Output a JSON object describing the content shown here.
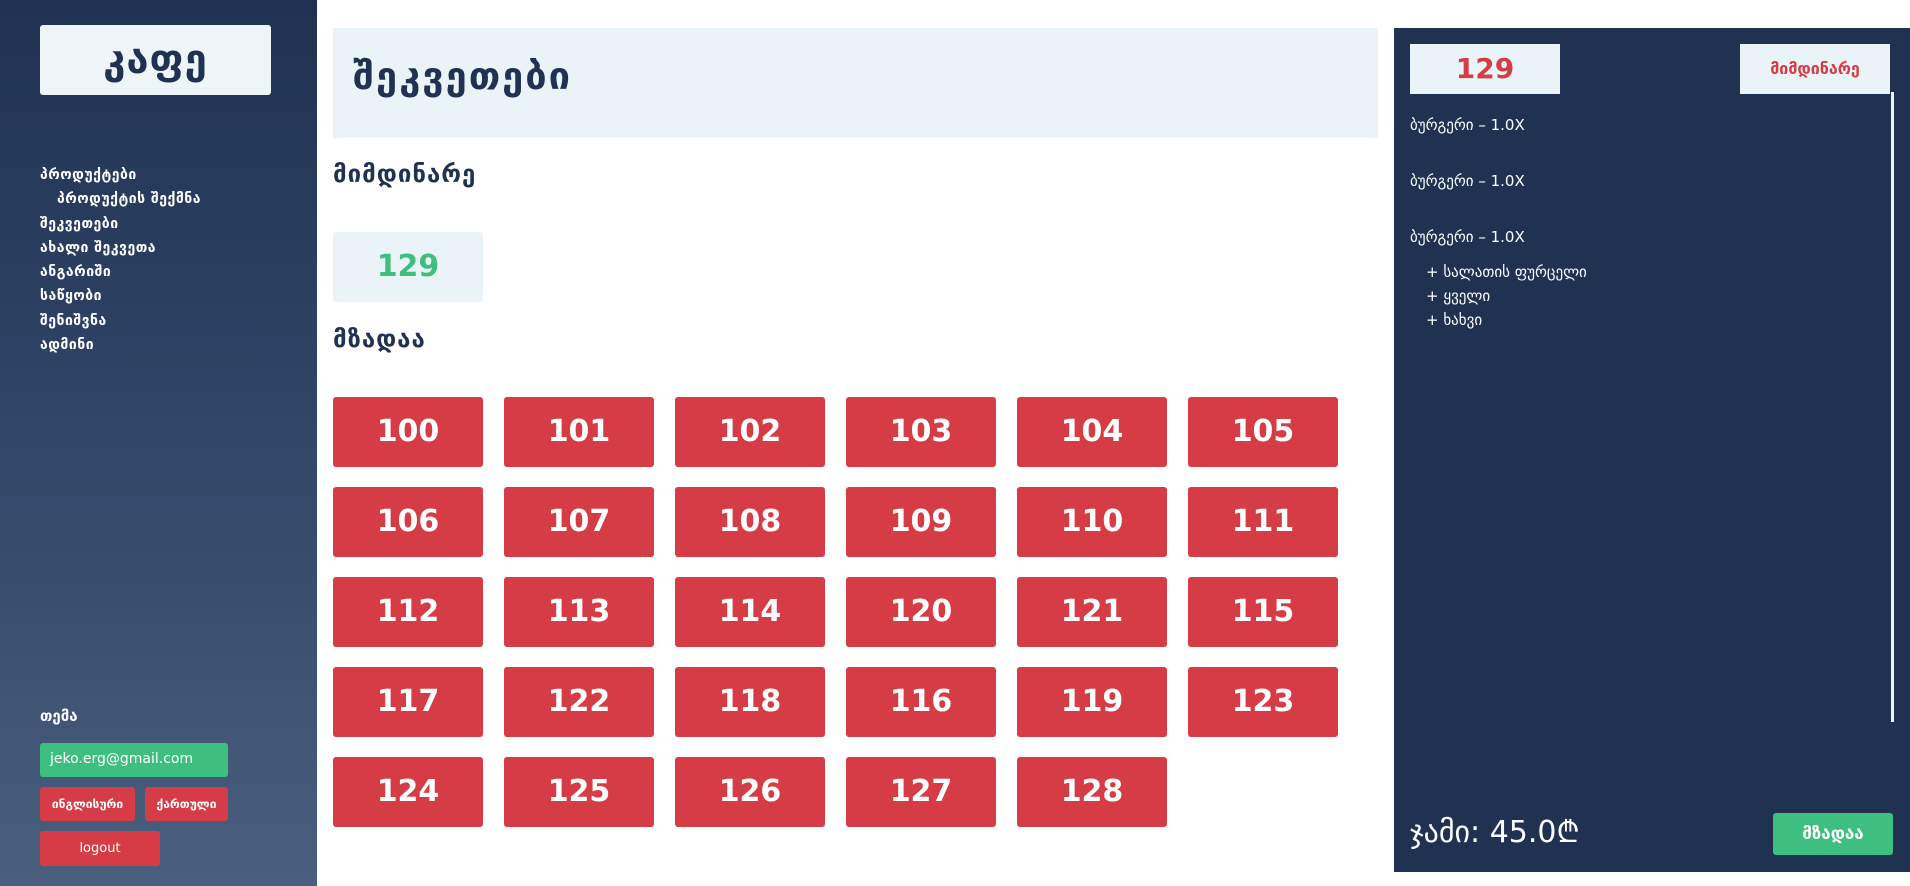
{
  "sidebar": {
    "logo": "კაფე",
    "nav": [
      {
        "label": "პროდუქტები",
        "sub": false
      },
      {
        "label": "პროდუქტის შექმნა",
        "sub": true
      },
      {
        "label": "შეკვეთები",
        "sub": false
      },
      {
        "label": "ახალი შეკვეთა",
        "sub": false
      },
      {
        "label": "ანგარიში",
        "sub": false
      },
      {
        "label": "საწყობი",
        "sub": false
      },
      {
        "label": "შენიშვნა",
        "sub": false
      },
      {
        "label": "ადმინი",
        "sub": false
      }
    ],
    "theme_label": "თემა",
    "email": "jeko.erg@gmail.com",
    "lang_en": "ინგლისური",
    "lang_ka": "ქართული",
    "logout": "logout"
  },
  "main": {
    "title": "შეკვეთები",
    "current_label": "მიმდინარე",
    "current_order": "129",
    "ready_label": "მზადაა",
    "ready_orders": [
      "100",
      "101",
      "102",
      "103",
      "104",
      "105",
      "106",
      "107",
      "108",
      "109",
      "110",
      "111",
      "112",
      "113",
      "114",
      "120",
      "121",
      "115",
      "117",
      "122",
      "118",
      "116",
      "119",
      "123",
      "124",
      "125",
      "126",
      "127",
      "128"
    ]
  },
  "panel": {
    "order_number": "129",
    "status": "მიმდინარე",
    "items": [
      {
        "line": "ბურგერი – 1.0X",
        "addons": []
      },
      {
        "line": "ბურგერი – 1.0X",
        "addons": []
      },
      {
        "line": "ბურგერი – 1.0X",
        "addons": [
          "+ სალათის ფურცელი",
          "+ ყველი",
          "+ ხახვი"
        ]
      }
    ],
    "total": "ჯამი: 45.0₾",
    "ready_button": "მზადაა"
  },
  "colors": {
    "navy": "#1f3252",
    "red": "#d63c45",
    "green": "#3fbf7f",
    "light": "#eaf3f7"
  }
}
